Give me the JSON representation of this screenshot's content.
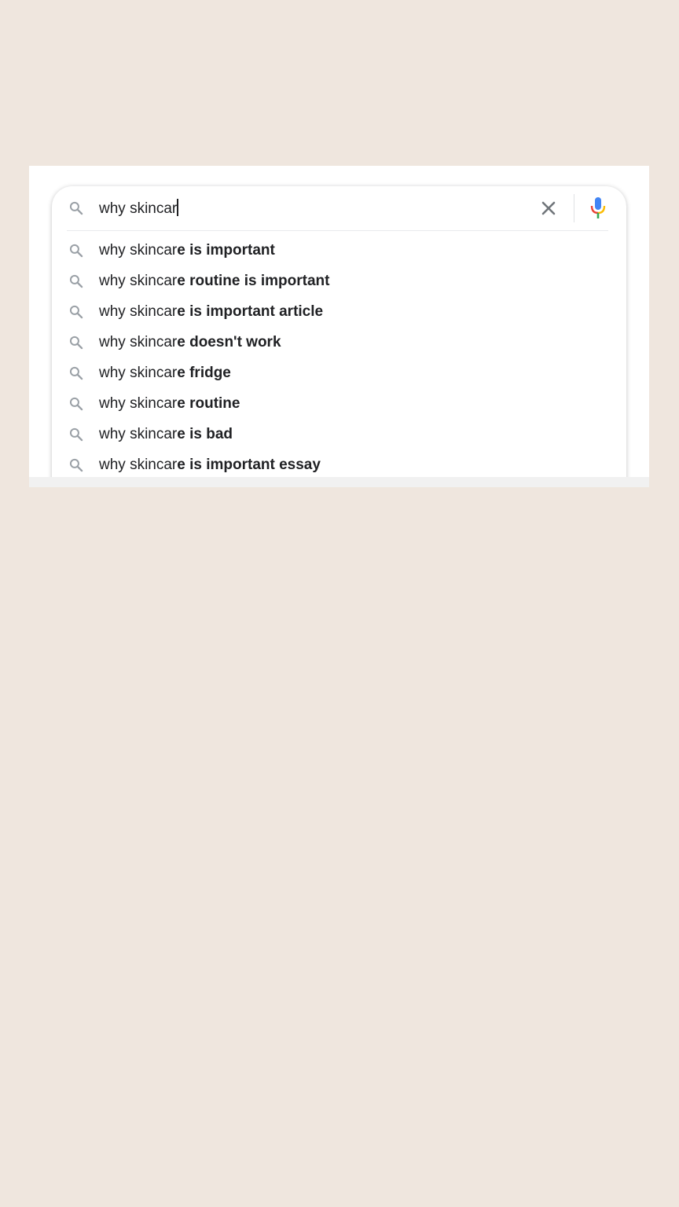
{
  "search": {
    "query": "why skincar",
    "clear_icon": "close-icon",
    "mic_icon": "microphone-icon"
  },
  "suggestions": [
    {
      "prefix": "why skincar",
      "completion": "e is important"
    },
    {
      "prefix": "why skincar",
      "completion": "e routine is important"
    },
    {
      "prefix": "why skincar",
      "completion": "e is important article"
    },
    {
      "prefix": "why skincar",
      "completion": "e doesn't work"
    },
    {
      "prefix": "why skincar",
      "completion": "e fridge"
    },
    {
      "prefix": "why skincar",
      "completion": "e routine"
    },
    {
      "prefix": "why skincar",
      "completion": "e is bad"
    },
    {
      "prefix": "why skincar",
      "completion": "e is important essay"
    }
  ],
  "colors": {
    "page_background": "#efe6de",
    "card_background": "#ffffff",
    "text": "#202124",
    "icon_gray": "#9aa0a6",
    "mic_blue": "#4285f4",
    "mic_red": "#ea4335",
    "mic_yellow": "#fbbc04",
    "mic_green": "#34a853"
  }
}
